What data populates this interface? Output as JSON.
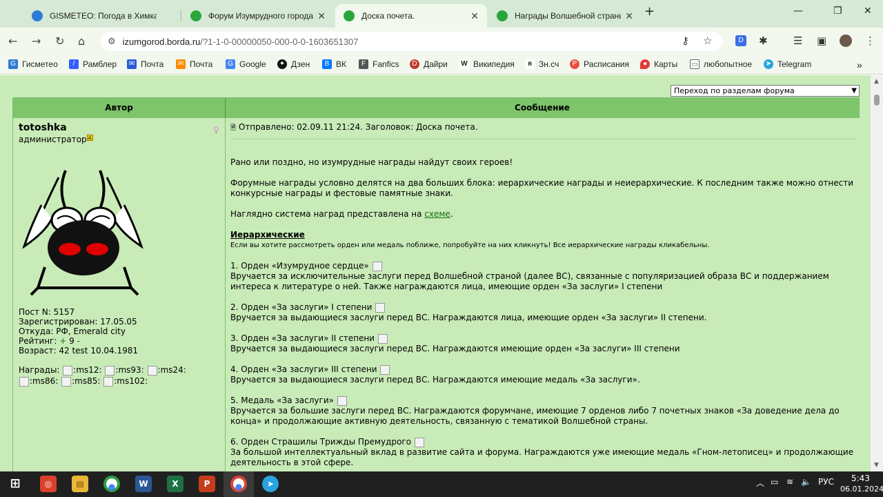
{
  "tabs": [
    {
      "title": "GISMETEO: Погода в Химках н",
      "color": "#2d7bd6"
    },
    {
      "title": "Форум Изумрудного города",
      "color": "#2aa53b"
    },
    {
      "title": "Доска почета.",
      "color": "#2aa53b"
    },
    {
      "title": "Награды Волшебной страны -",
      "color": "#2aa53b"
    }
  ],
  "omnibox": {
    "host": "izumgorod.borda.ru",
    "path": "/?1-1-0-00000050-000-0-0-1603651307"
  },
  "bookmarks": [
    {
      "label": "Гисметео",
      "icon": "G",
      "color": "#2d7bd6"
    },
    {
      "label": "Рамблер",
      "icon": "/",
      "color": "#315efb"
    },
    {
      "label": "Почта",
      "icon": "✉",
      "color": "#2a5ad8"
    },
    {
      "label": "Почта",
      "icon": "✉",
      "color": "#ff8a00"
    },
    {
      "label": "Google",
      "icon": "G",
      "color": "#4285f4"
    },
    {
      "label": "Дзен",
      "icon": "✦",
      "color": "#111111"
    },
    {
      "label": "ВК",
      "icon": "B",
      "color": "#0077ff"
    },
    {
      "label": "Fanfics",
      "icon": "F",
      "color": "#555555"
    },
    {
      "label": "Дайри",
      "icon": "D",
      "color": "#c0392b"
    },
    {
      "label": "Википедия",
      "icon": "W",
      "color": "#333333"
    },
    {
      "label": "Зн.сч",
      "icon": "я",
      "color": "#444444"
    },
    {
      "label": "Расписания",
      "icon": "Р",
      "color": "#e74c3c"
    },
    {
      "label": "Карты",
      "icon": "●",
      "color": "#e53935"
    },
    {
      "label": "любопытное",
      "icon": "▭",
      "color": "#777777"
    },
    {
      "label": "Telegram",
      "icon": "➤",
      "color": "#2aa3e0"
    }
  ],
  "forum": {
    "jump_label": "Переход по разделам форума",
    "col_author": "Автор",
    "col_message": "Сообщение",
    "author": {
      "name": "totoshka",
      "role": "администратор",
      "badge": "A",
      "post_no": "Пост N: 5157",
      "registered": "Зарегистрирован: 17.05.05",
      "from": "Откуда: РФ, Emerald city",
      "rating_label": "Рейтинг:",
      "rating_plus": "+",
      "rating_value": "9",
      "rating_minus": "-",
      "age": "Возраст: 42 test 10.04.1981",
      "awards_label": "Награды:",
      "awards": [
        ":ms12:",
        ":ms93:",
        ":ms24:",
        ":ms86:",
        ":ms85:",
        ":ms102:"
      ]
    },
    "post": {
      "header": "Отправлено: 02.09.11 21:24. Заголовок: Доска почета.",
      "p1": "Рано или поздно, но изумрудные награды найдут своих героев!",
      "p2": "Форумные награды условно делятся на два больших блока: иерархические награды и неиерархические. К последним также можно отнести конкурсные награды и фестовые памятные знаки.",
      "p3_text": "Наглядно система наград представлена на",
      "p3_link": "схеме",
      "section": "Иерархические",
      "section_note": "Если вы хотите рассмотреть орден или медаль поближе, попробуйте на них кликнуть! Все иерархические награды кликабельны.",
      "items": [
        {
          "title": "1. Орден «Изумрудное сердце»",
          "desc": "Вручается за исключительные заслуги перед Волшебной страной (далее ВС), связанные с популяризацией образа ВС и поддержанием интереса к литературе о ней. Также награждаются лица, имеющие орден «За заслуги» I степени"
        },
        {
          "title": "2. Орден «За заслуги» I степени",
          "desc": "Вручается за выдающиеся заслуги перед ВС. Награждаются лица, имеющие орден «За заслуги» II степени."
        },
        {
          "title": "3. Орден «За заслуги» II степени",
          "desc": "Вручается за выдающиеся заслуги перед ВС. Награждаются имеющие орден «За заслуги» III степени"
        },
        {
          "title": "4. Орден «За заслуги» III степени",
          "desc": "Вручается за выдающиеся заслуги перед ВС. Награждаются имеющие медаль «За заслуги»."
        },
        {
          "title": "5. Медаль «За заслуги»",
          "desc": "Вручается за большие заслуги перед ВС. Награждаются форумчане, имеющие 7 орденов либо 7 почетных знаков «За доведение дела до конца» и продолжающие активную деятельность, связанную с тематикой Волшебной страны."
        },
        {
          "title": "6. Орден Страшилы Трижды Премудрого",
          "desc": "За большой интеллектуальный вклад в развитие сайта и форума. Награждаются уже имеющие медаль «Гном-летописец» и продолжающие деятельность в этой сфере."
        }
      ]
    }
  },
  "tray": {
    "lang": "РУС",
    "time": "5:43",
    "date": "06.01.2024"
  }
}
